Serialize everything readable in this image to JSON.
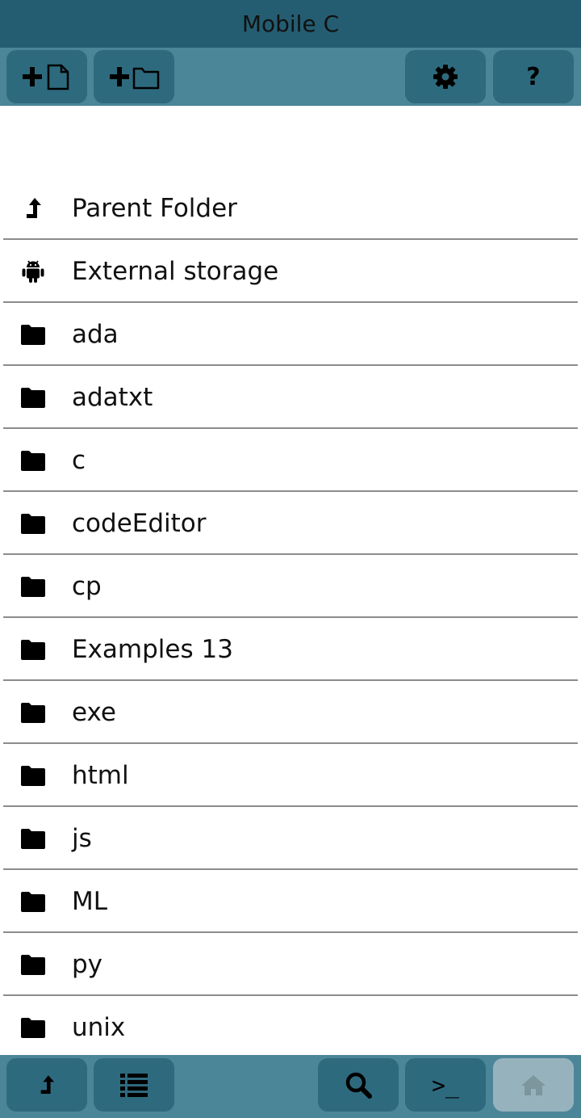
{
  "app": {
    "title": "Mobile C"
  },
  "toolbar": [
    {
      "name": "new-file-button",
      "icon": "plus-file-icon"
    },
    {
      "name": "new-folder-button",
      "icon": "plus-folder-icon"
    },
    {
      "name": "settings-button",
      "icon": "gear-icon"
    },
    {
      "name": "help-button",
      "icon": "question-icon",
      "label": "?"
    }
  ],
  "list": {
    "items": [
      {
        "label": "Parent Folder",
        "icon": "parent-folder-icon"
      },
      {
        "label": "External storage",
        "icon": "android-icon"
      },
      {
        "label": "ada",
        "icon": "folder-icon"
      },
      {
        "label": "adatxt",
        "icon": "folder-icon"
      },
      {
        "label": "c",
        "icon": "folder-icon"
      },
      {
        "label": "codeEditor",
        "icon": "folder-icon"
      },
      {
        "label": "cp",
        "icon": "folder-icon"
      },
      {
        "label": "Examples 13",
        "icon": "folder-icon"
      },
      {
        "label": "exe",
        "icon": "folder-icon"
      },
      {
        "label": "html",
        "icon": "folder-icon"
      },
      {
        "label": "js",
        "icon": "folder-icon"
      },
      {
        "label": "ML",
        "icon": "folder-icon"
      },
      {
        "label": "py",
        "icon": "folder-icon"
      },
      {
        "label": "unix",
        "icon": "folder-icon"
      }
    ]
  },
  "bottombar": [
    {
      "name": "up-button",
      "icon": "parent-folder-icon"
    },
    {
      "name": "list-button",
      "icon": "list-icon"
    },
    {
      "name": "search-button",
      "icon": "search-icon"
    },
    {
      "name": "terminal-button",
      "icon": "terminal-icon",
      "label": ">_"
    },
    {
      "name": "home-button",
      "icon": "home-icon",
      "disabled": true
    }
  ]
}
